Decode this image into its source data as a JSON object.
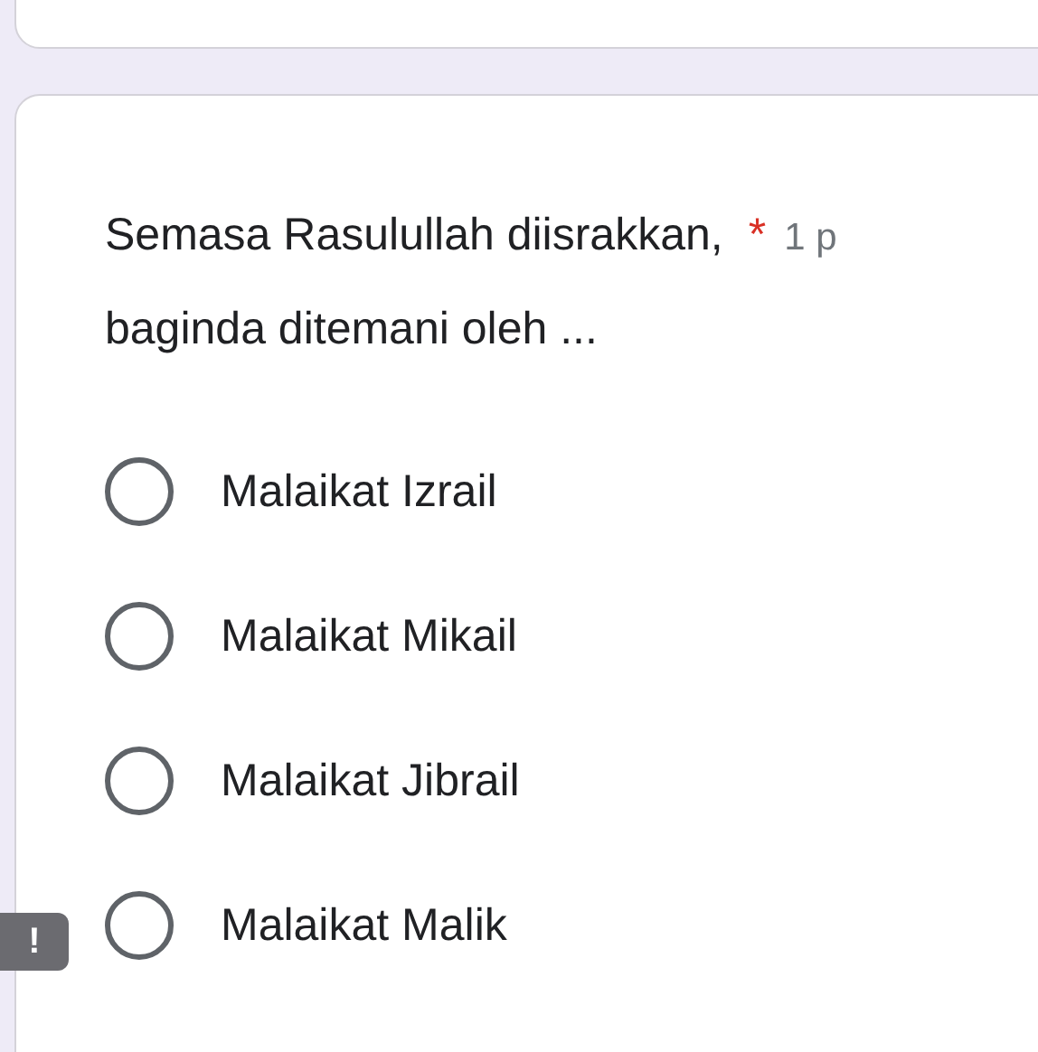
{
  "question": {
    "title_lines": [
      "Semasa Rasulullah diisrakkan,",
      "baginda ditemani oleh ..."
    ],
    "required_mark": "*",
    "points": "1 p"
  },
  "options": [
    {
      "label": "Malaikat Izrail",
      "selected": false
    },
    {
      "label": "Malaikat Mikail",
      "selected": false
    },
    {
      "label": "Malaikat Jibrail",
      "selected": false
    },
    {
      "label": "Malaikat Malik",
      "selected": false
    }
  ],
  "warning_badge": "!"
}
